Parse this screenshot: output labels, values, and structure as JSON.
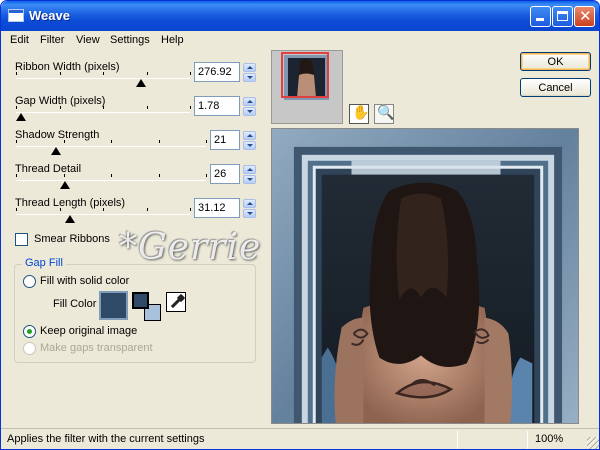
{
  "window": {
    "title": "Weave"
  },
  "menu": [
    "Edit",
    "Filter",
    "View",
    "Settings",
    "Help"
  ],
  "controls": [
    {
      "label": "Ribbon Width (pixels)",
      "value": "276.92",
      "level": 0.72
    },
    {
      "label": "Gap Width (pixels)",
      "value": "1.78",
      "level": 0.03
    },
    {
      "label": "Shadow Strength",
      "value": "21",
      "level": 0.21
    },
    {
      "label": "Thread Detail",
      "value": "26",
      "level": 0.26
    },
    {
      "label": "Thread Length (pixels)",
      "value": "31.12",
      "level": 0.31
    }
  ],
  "smear": {
    "label": "Smear Ribbons",
    "checked": false
  },
  "gap_fill": {
    "title": "Gap Fill",
    "solid_label": "Fill with solid color",
    "fill_color_label": "Fill Color",
    "fill_color": "#2f4a66",
    "swatch_fg": "#2f4a66",
    "swatch_bg": "#a9c2dc",
    "keep_label": "Keep original image",
    "transparent_label": "Make gaps transparent"
  },
  "watermark": "*Gerrie *",
  "tools": {
    "pan": "hand-icon",
    "zoom": "magnifier-icon"
  },
  "buttons": {
    "ok": "OK",
    "cancel": "Cancel"
  },
  "status": {
    "text": "Applies the filter with the current settings",
    "zoom": "100%"
  },
  "colors": {
    "title_blue": "#0b46cf",
    "preview_frame": "#7b97b1",
    "skin": "#c49a82",
    "hair": "#1f1512"
  }
}
